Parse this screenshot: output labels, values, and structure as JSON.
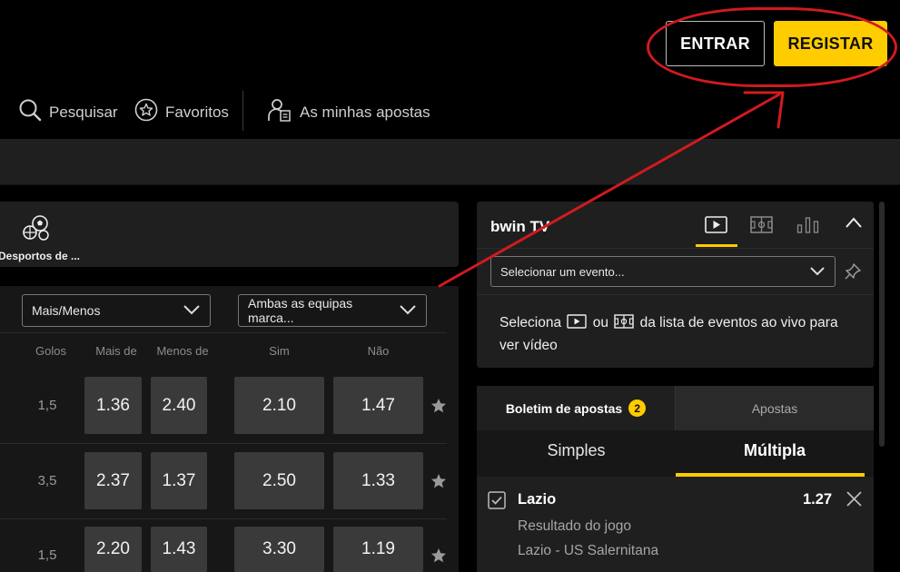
{
  "header": {
    "login_label": "ENTRAR",
    "register_label": "REGISTAR"
  },
  "nav": {
    "search_label": "Pesquisar",
    "favorites_label": "Favoritos",
    "my_bets_label": "As minhas apostas"
  },
  "sports": {
    "label": "Desportos de ..."
  },
  "markets": {
    "select1": "Mais/Menos",
    "select2": "Ambas as equipas marca...",
    "headers": {
      "goals": "Golos",
      "over": "Mais de",
      "under": "Menos de",
      "yes": "Sim",
      "no": "Não"
    },
    "rows": [
      {
        "goals": "1,5",
        "over": "1.36",
        "under": "2.40",
        "yes": "2.10",
        "no": "1.47"
      },
      {
        "goals": "3,5",
        "over": "2.37",
        "under": "1.37",
        "yes": "2.50",
        "no": "1.33"
      },
      {
        "goals": "1,5",
        "over": "2.20",
        "under": "1.43",
        "yes": "3.30",
        "no": "1.19"
      }
    ]
  },
  "tv": {
    "title": "bwin TV",
    "select_placeholder": "Selecionar um evento...",
    "message_part1": "Seleciona",
    "message_part2": "ou",
    "message_part3": "da lista de eventos ao vivo para",
    "message_part4": "ver vídeo"
  },
  "betslip": {
    "tab_slip": "Boletim de apostas",
    "slip_count": "2",
    "tab_bets": "Apostas",
    "mode_single": "Simples",
    "mode_multiple": "Múltipla",
    "selection": {
      "team": "Lazio",
      "odds": "1.27",
      "market": "Resultado do jogo",
      "event": "Lazio - US Salernitana"
    }
  },
  "colors": {
    "accent": "#ffcc00",
    "annotation": "#d11a1f"
  }
}
